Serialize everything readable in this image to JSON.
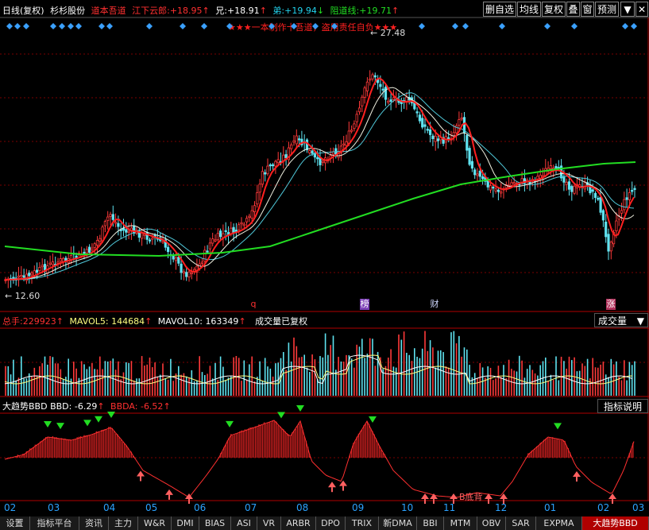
{
  "header": {
    "period": "日线(复权)",
    "stock_name": "杉杉股份",
    "indicator_name": "道本吾道",
    "items": [
      {
        "label": "江下云郎:",
        "value": "+18.95",
        "arrow": "↑",
        "color": "#ff3030"
      },
      {
        "label": "兄:",
        "value": "+18.91",
        "arrow": "↑",
        "color": "#ffffff"
      },
      {
        "label": "弟:",
        "value": "+19.94",
        "arrow": "↓",
        "color": "#22d3ee"
      },
      {
        "label": "阻道线:",
        "value": "+19.71",
        "arrow": "↑",
        "color": "#22dd22"
      }
    ],
    "buttons": [
      "删自选",
      "均线",
      "复权",
      "叠",
      "窗",
      "预测"
    ],
    "banner": "★★★一本制作十吾道，盗用责任自负★★★"
  },
  "main_chart": {
    "high_label": "27.48",
    "low_label": "12.60",
    "events": [
      {
        "text": "q",
        "color": "#ff3030"
      },
      {
        "text": "榜",
        "color": "#ffffff",
        "bg": "#7b3fb5"
      },
      {
        "text": "财",
        "color": "#cfd8ff"
      },
      {
        "text": "涨",
        "color": "#ffffff",
        "bg": "#b0305a"
      }
    ]
  },
  "volume": {
    "total_label": "总手:",
    "total_value": "229923",
    "total_arrow": "↑",
    "mavol5_label": "MAVOL5:",
    "mavol5_value": "144684",
    "mavol5_arrow": "↑",
    "mavol10_label": "MAVOL10:",
    "mavol10_value": "163349",
    "mavol10_arrow": "↑",
    "note": "成交量已复权",
    "dropdown": "成交量"
  },
  "indicator": {
    "name": "大趋势BBD",
    "bbd_label": "BBD:",
    "bbd_value": "-6.29",
    "bbd_arrow": "↑",
    "bbda_label": "BBDA:",
    "bbda_value": "-6.52",
    "bbda_arrow": "↑",
    "button": "指标说明",
    "annotation": "B底背"
  },
  "x_axis": {
    "months": [
      "02",
      "03",
      "04",
      "05",
      "06",
      "07",
      "08",
      "09",
      "10",
      "11",
      "12",
      "01",
      "02",
      "03"
    ]
  },
  "bottom_tabs": [
    "设置",
    "指标平台",
    "资讯",
    "主力",
    "W&R",
    "DMI",
    "BIAS",
    "ASI",
    "VR",
    "ARBR",
    "DPO",
    "TRIX",
    "新DMA",
    "BBI",
    "MTM",
    "OBV",
    "SAR",
    "EXPMA",
    "大趋势BBD"
  ],
  "colors": {
    "up": "#ff3a3a",
    "down": "#5fe3f0",
    "ma_red": "#ff2020",
    "ma_white": "#f0f0e0",
    "ma_cyan": "#4fc7d8",
    "ma_green": "#22dd22",
    "grid": "#7a0000",
    "axis_month": "#2aa2ff"
  }
}
